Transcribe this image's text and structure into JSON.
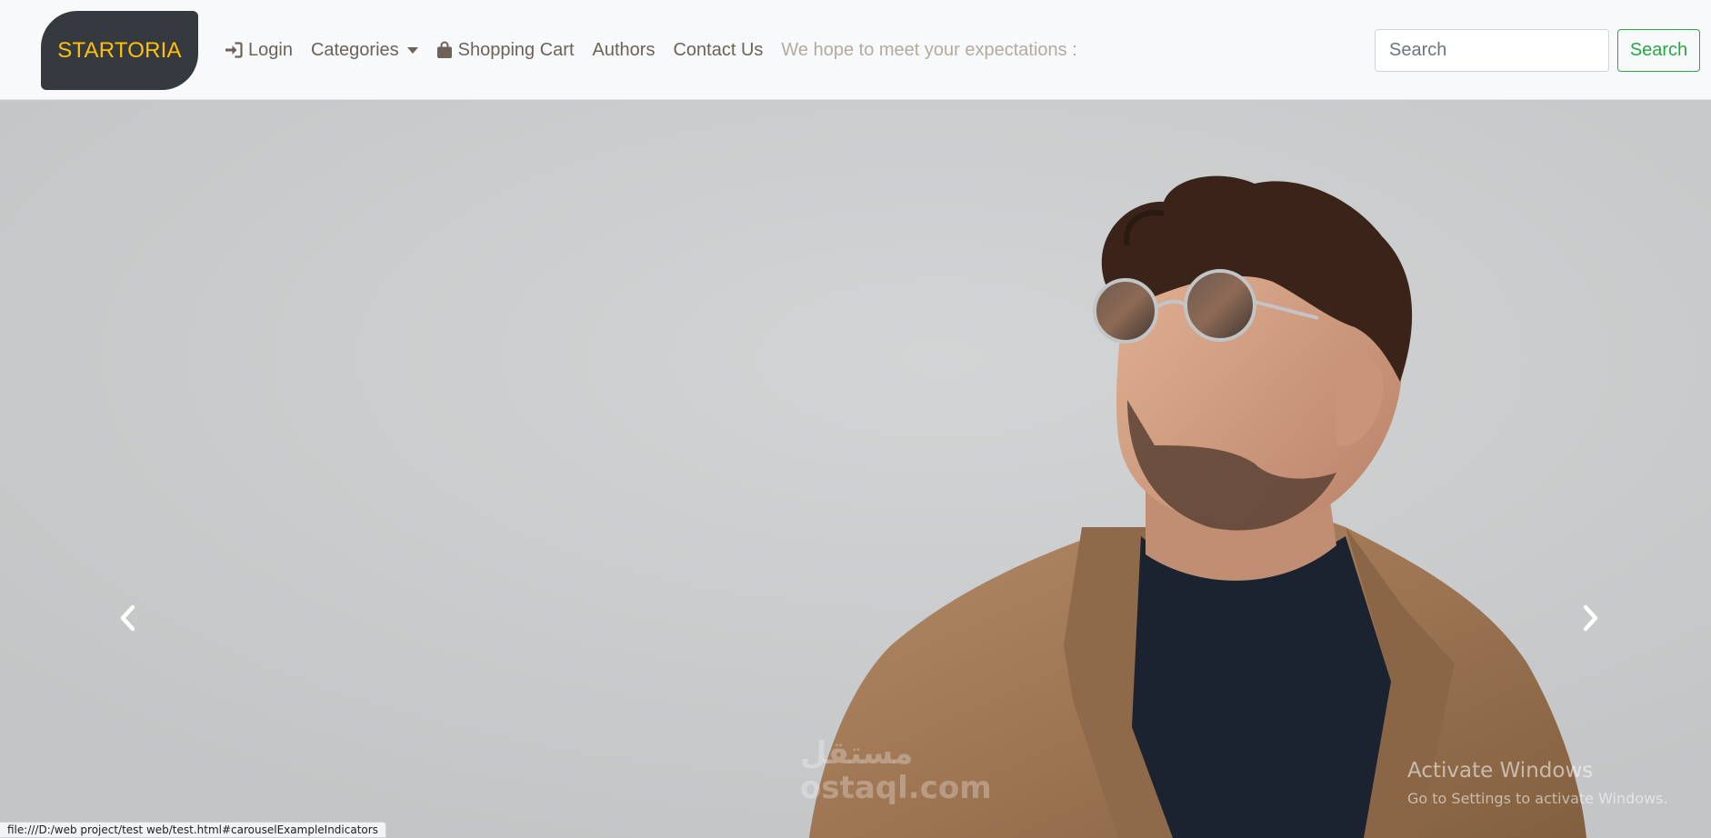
{
  "navbar": {
    "brand": "STARTORIA",
    "items": [
      {
        "label": "Login",
        "icon": "sign-in-icon"
      },
      {
        "label": "Categories",
        "icon": "chevron-down-icon"
      },
      {
        "label": "Shopping Cart",
        "icon": "shopping-bag-icon"
      },
      {
        "label": "Authors"
      },
      {
        "label": "Contact Us"
      }
    ],
    "tagline": "We hope to meet your expectations :",
    "search": {
      "placeholder": "Search",
      "button_label": "Search"
    }
  },
  "carousel": {
    "prev_icon": "chevron-left-icon",
    "next_icon": "chevron-right-icon"
  },
  "overlay": {
    "activate_title": "Activate Windows",
    "activate_sub": "Go to Settings to activate Windows.",
    "watermark_text": "مستقل",
    "watermark_domain": "ostaql.com"
  },
  "status_bar": {
    "url": "file:///D:/web project/test web/test.html#carouselExampleIndicators"
  },
  "colors": {
    "brand_bg": "#343a40",
    "brand_text": "#ffc107",
    "nav_text": "#6c6258",
    "tagline_text": "#b4aa9e",
    "search_btn": "#28a745"
  }
}
